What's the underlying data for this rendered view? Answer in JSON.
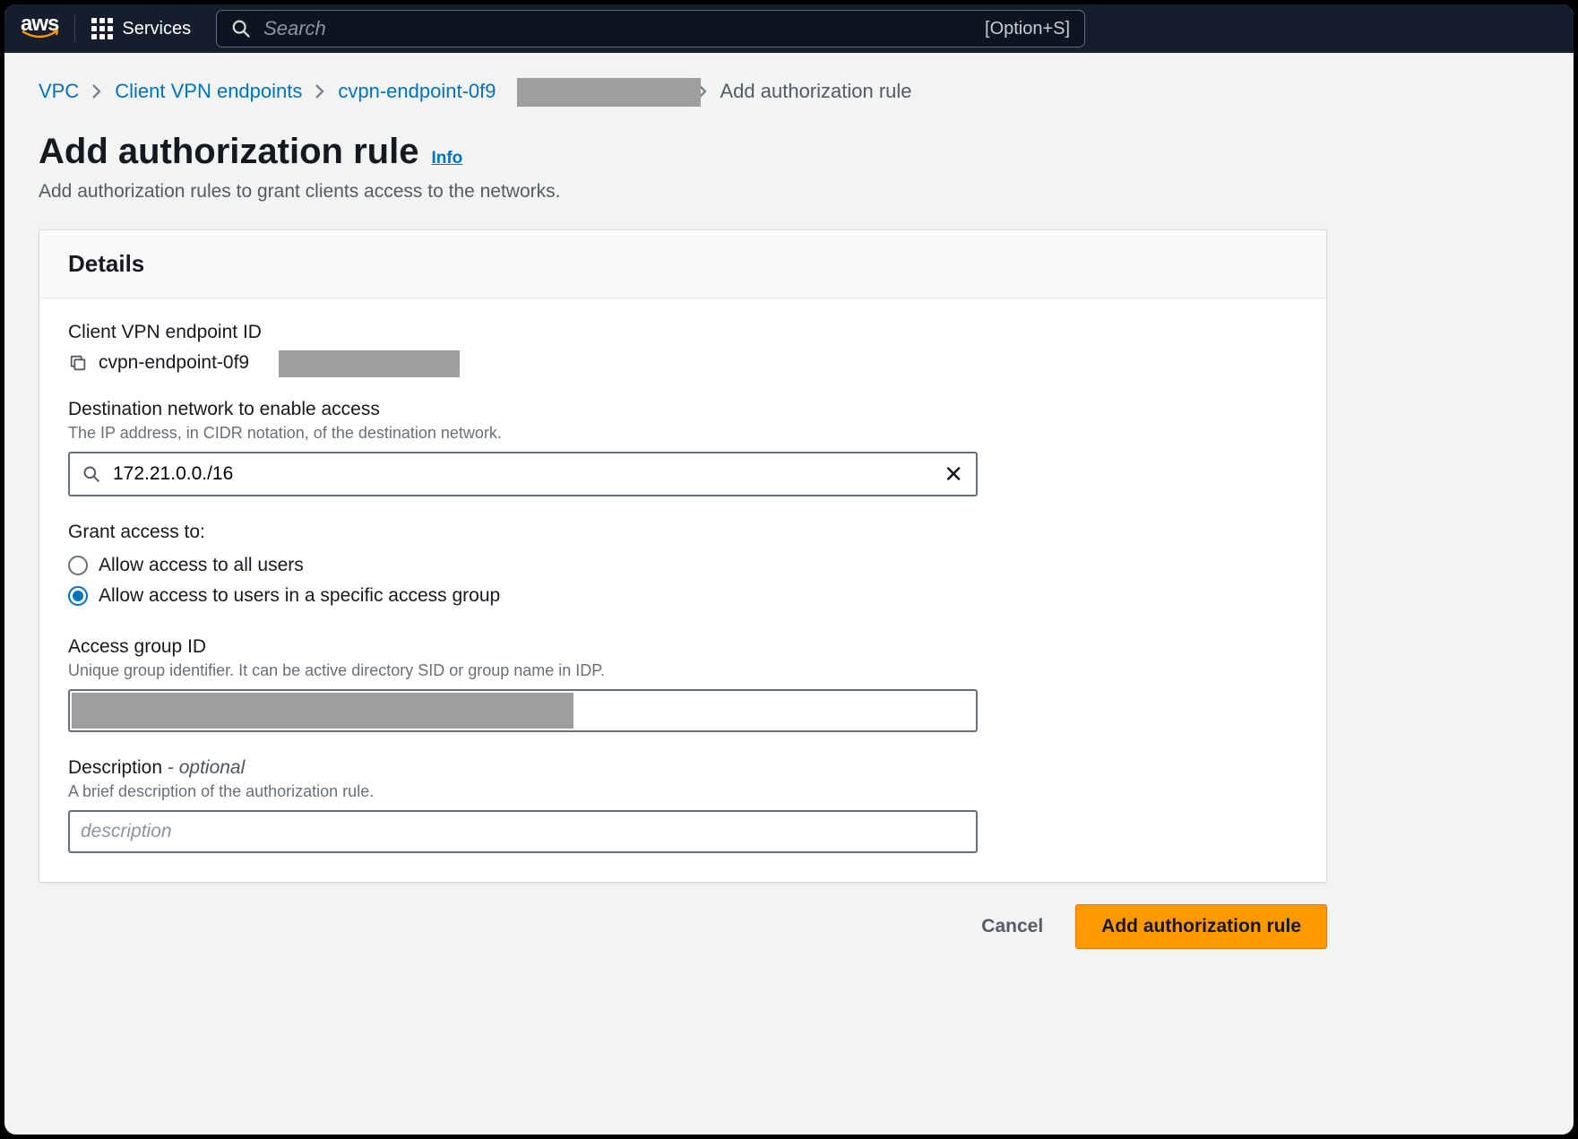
{
  "header": {
    "logo_text": "aws",
    "services_label": "Services",
    "search_placeholder": "Search",
    "search_shortcut": "[Option+S]"
  },
  "breadcrumb": {
    "root": "VPC",
    "level2": "Client VPN endpoints",
    "level3": "cvpn-endpoint-0f9",
    "current": "Add authorization rule"
  },
  "page": {
    "title": "Add authorization rule",
    "info_label": "Info",
    "subtitle": "Add authorization rules to grant clients access to the networks."
  },
  "panel": {
    "heading": "Details",
    "endpoint_id_label": "Client VPN endpoint ID",
    "endpoint_id_value": "cvpn-endpoint-0f9",
    "destination_label": "Destination network to enable access",
    "destination_hint": "The IP address, in CIDR notation, of the destination network.",
    "destination_value": "172.21.0.0./16",
    "grant_label": "Grant access to:",
    "radio_all": "Allow access to all users",
    "radio_group": "Allow access to users in a specific access group",
    "radio_selected": "group",
    "access_group_label": "Access group ID",
    "access_group_hint": "Unique group identifier. It can be active directory SID or group name in IDP.",
    "access_group_value": "",
    "description_label": "Description",
    "description_optional": " - optional",
    "description_hint": "A brief description of the authorization rule.",
    "description_placeholder": "description",
    "description_value": ""
  },
  "actions": {
    "cancel": "Cancel",
    "submit": "Add authorization rule"
  }
}
